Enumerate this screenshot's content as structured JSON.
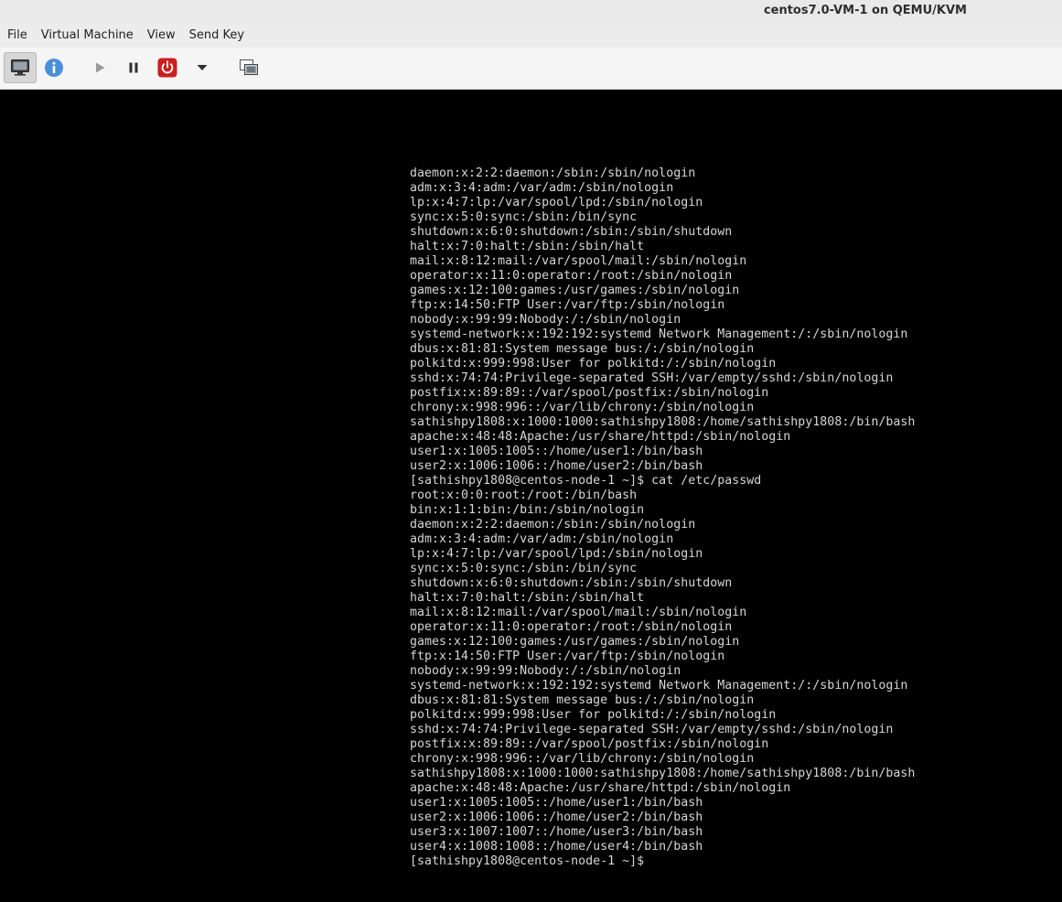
{
  "window": {
    "title": "centos7.0-VM-1 on QEMU/KVM"
  },
  "menubar": {
    "items": [
      "File",
      "Virtual Machine",
      "View",
      "Send Key"
    ]
  },
  "toolbar": {
    "buttons": [
      {
        "name": "console-view-button",
        "icon": "monitor-icon",
        "active": true
      },
      {
        "name": "details-button",
        "icon": "info-icon",
        "color": "#4a90d9"
      },
      {
        "name": "run-button",
        "icon": "play-icon"
      },
      {
        "name": "pause-button",
        "icon": "pause-icon"
      },
      {
        "name": "shutdown-button",
        "icon": "power-icon",
        "color": "#cc1f1f"
      },
      {
        "name": "shutdown-menu-button",
        "icon": "chevron-down-icon"
      },
      {
        "name": "fullscreen-button",
        "icon": "fullscreen-icon"
      }
    ]
  },
  "console": {
    "background": "#000000",
    "text_color": "#d6d6d6",
    "lines": [
      "daemon:x:2:2:daemon:/sbin:/sbin/nologin",
      "adm:x:3:4:adm:/var/adm:/sbin/nologin",
      "lp:x:4:7:lp:/var/spool/lpd:/sbin/nologin",
      "sync:x:5:0:sync:/sbin:/bin/sync",
      "shutdown:x:6:0:shutdown:/sbin:/sbin/shutdown",
      "halt:x:7:0:halt:/sbin:/sbin/halt",
      "mail:x:8:12:mail:/var/spool/mail:/sbin/nologin",
      "operator:x:11:0:operator:/root:/sbin/nologin",
      "games:x:12:100:games:/usr/games:/sbin/nologin",
      "ftp:x:14:50:FTP User:/var/ftp:/sbin/nologin",
      "nobody:x:99:99:Nobody:/:/sbin/nologin",
      "systemd-network:x:192:192:systemd Network Management:/:/sbin/nologin",
      "dbus:x:81:81:System message bus:/:/sbin/nologin",
      "polkitd:x:999:998:User for polkitd:/:/sbin/nologin",
      "sshd:x:74:74:Privilege-separated SSH:/var/empty/sshd:/sbin/nologin",
      "postfix:x:89:89::/var/spool/postfix:/sbin/nologin",
      "chrony:x:998:996::/var/lib/chrony:/sbin/nologin",
      "sathishpy1808:x:1000:1000:sathishpy1808:/home/sathishpy1808:/bin/bash",
      "apache:x:48:48:Apache:/usr/share/httpd:/sbin/nologin",
      "user1:x:1005:1005::/home/user1:/bin/bash",
      "user2:x:1006:1006::/home/user2:/bin/bash",
      "[sathishpy1808@centos-node-1 ~]$ cat /etc/passwd",
      "root:x:0:0:root:/root:/bin/bash",
      "bin:x:1:1:bin:/bin:/sbin/nologin",
      "daemon:x:2:2:daemon:/sbin:/sbin/nologin",
      "adm:x:3:4:adm:/var/adm:/sbin/nologin",
      "lp:x:4:7:lp:/var/spool/lpd:/sbin/nologin",
      "sync:x:5:0:sync:/sbin:/bin/sync",
      "shutdown:x:6:0:shutdown:/sbin:/sbin/shutdown",
      "halt:x:7:0:halt:/sbin:/sbin/halt",
      "mail:x:8:12:mail:/var/spool/mail:/sbin/nologin",
      "operator:x:11:0:operator:/root:/sbin/nologin",
      "games:x:12:100:games:/usr/games:/sbin/nologin",
      "ftp:x:14:50:FTP User:/var/ftp:/sbin/nologin",
      "nobody:x:99:99:Nobody:/:/sbin/nologin",
      "systemd-network:x:192:192:systemd Network Management:/:/sbin/nologin",
      "dbus:x:81:81:System message bus:/:/sbin/nologin",
      "polkitd:x:999:998:User for polkitd:/:/sbin/nologin",
      "sshd:x:74:74:Privilege-separated SSH:/var/empty/sshd:/sbin/nologin",
      "postfix:x:89:89::/var/spool/postfix:/sbin/nologin",
      "chrony:x:998:996::/var/lib/chrony:/sbin/nologin",
      "sathishpy1808:x:1000:1000:sathishpy1808:/home/sathishpy1808:/bin/bash",
      "apache:x:48:48:Apache:/usr/share/httpd:/sbin/nologin",
      "user1:x:1005:1005::/home/user1:/bin/bash",
      "user2:x:1006:1006::/home/user2:/bin/bash",
      "user3:x:1007:1007::/home/user3:/bin/bash",
      "user4:x:1008:1008::/home/user4:/bin/bash",
      "[sathishpy1808@centos-node-1 ~]$"
    ]
  }
}
